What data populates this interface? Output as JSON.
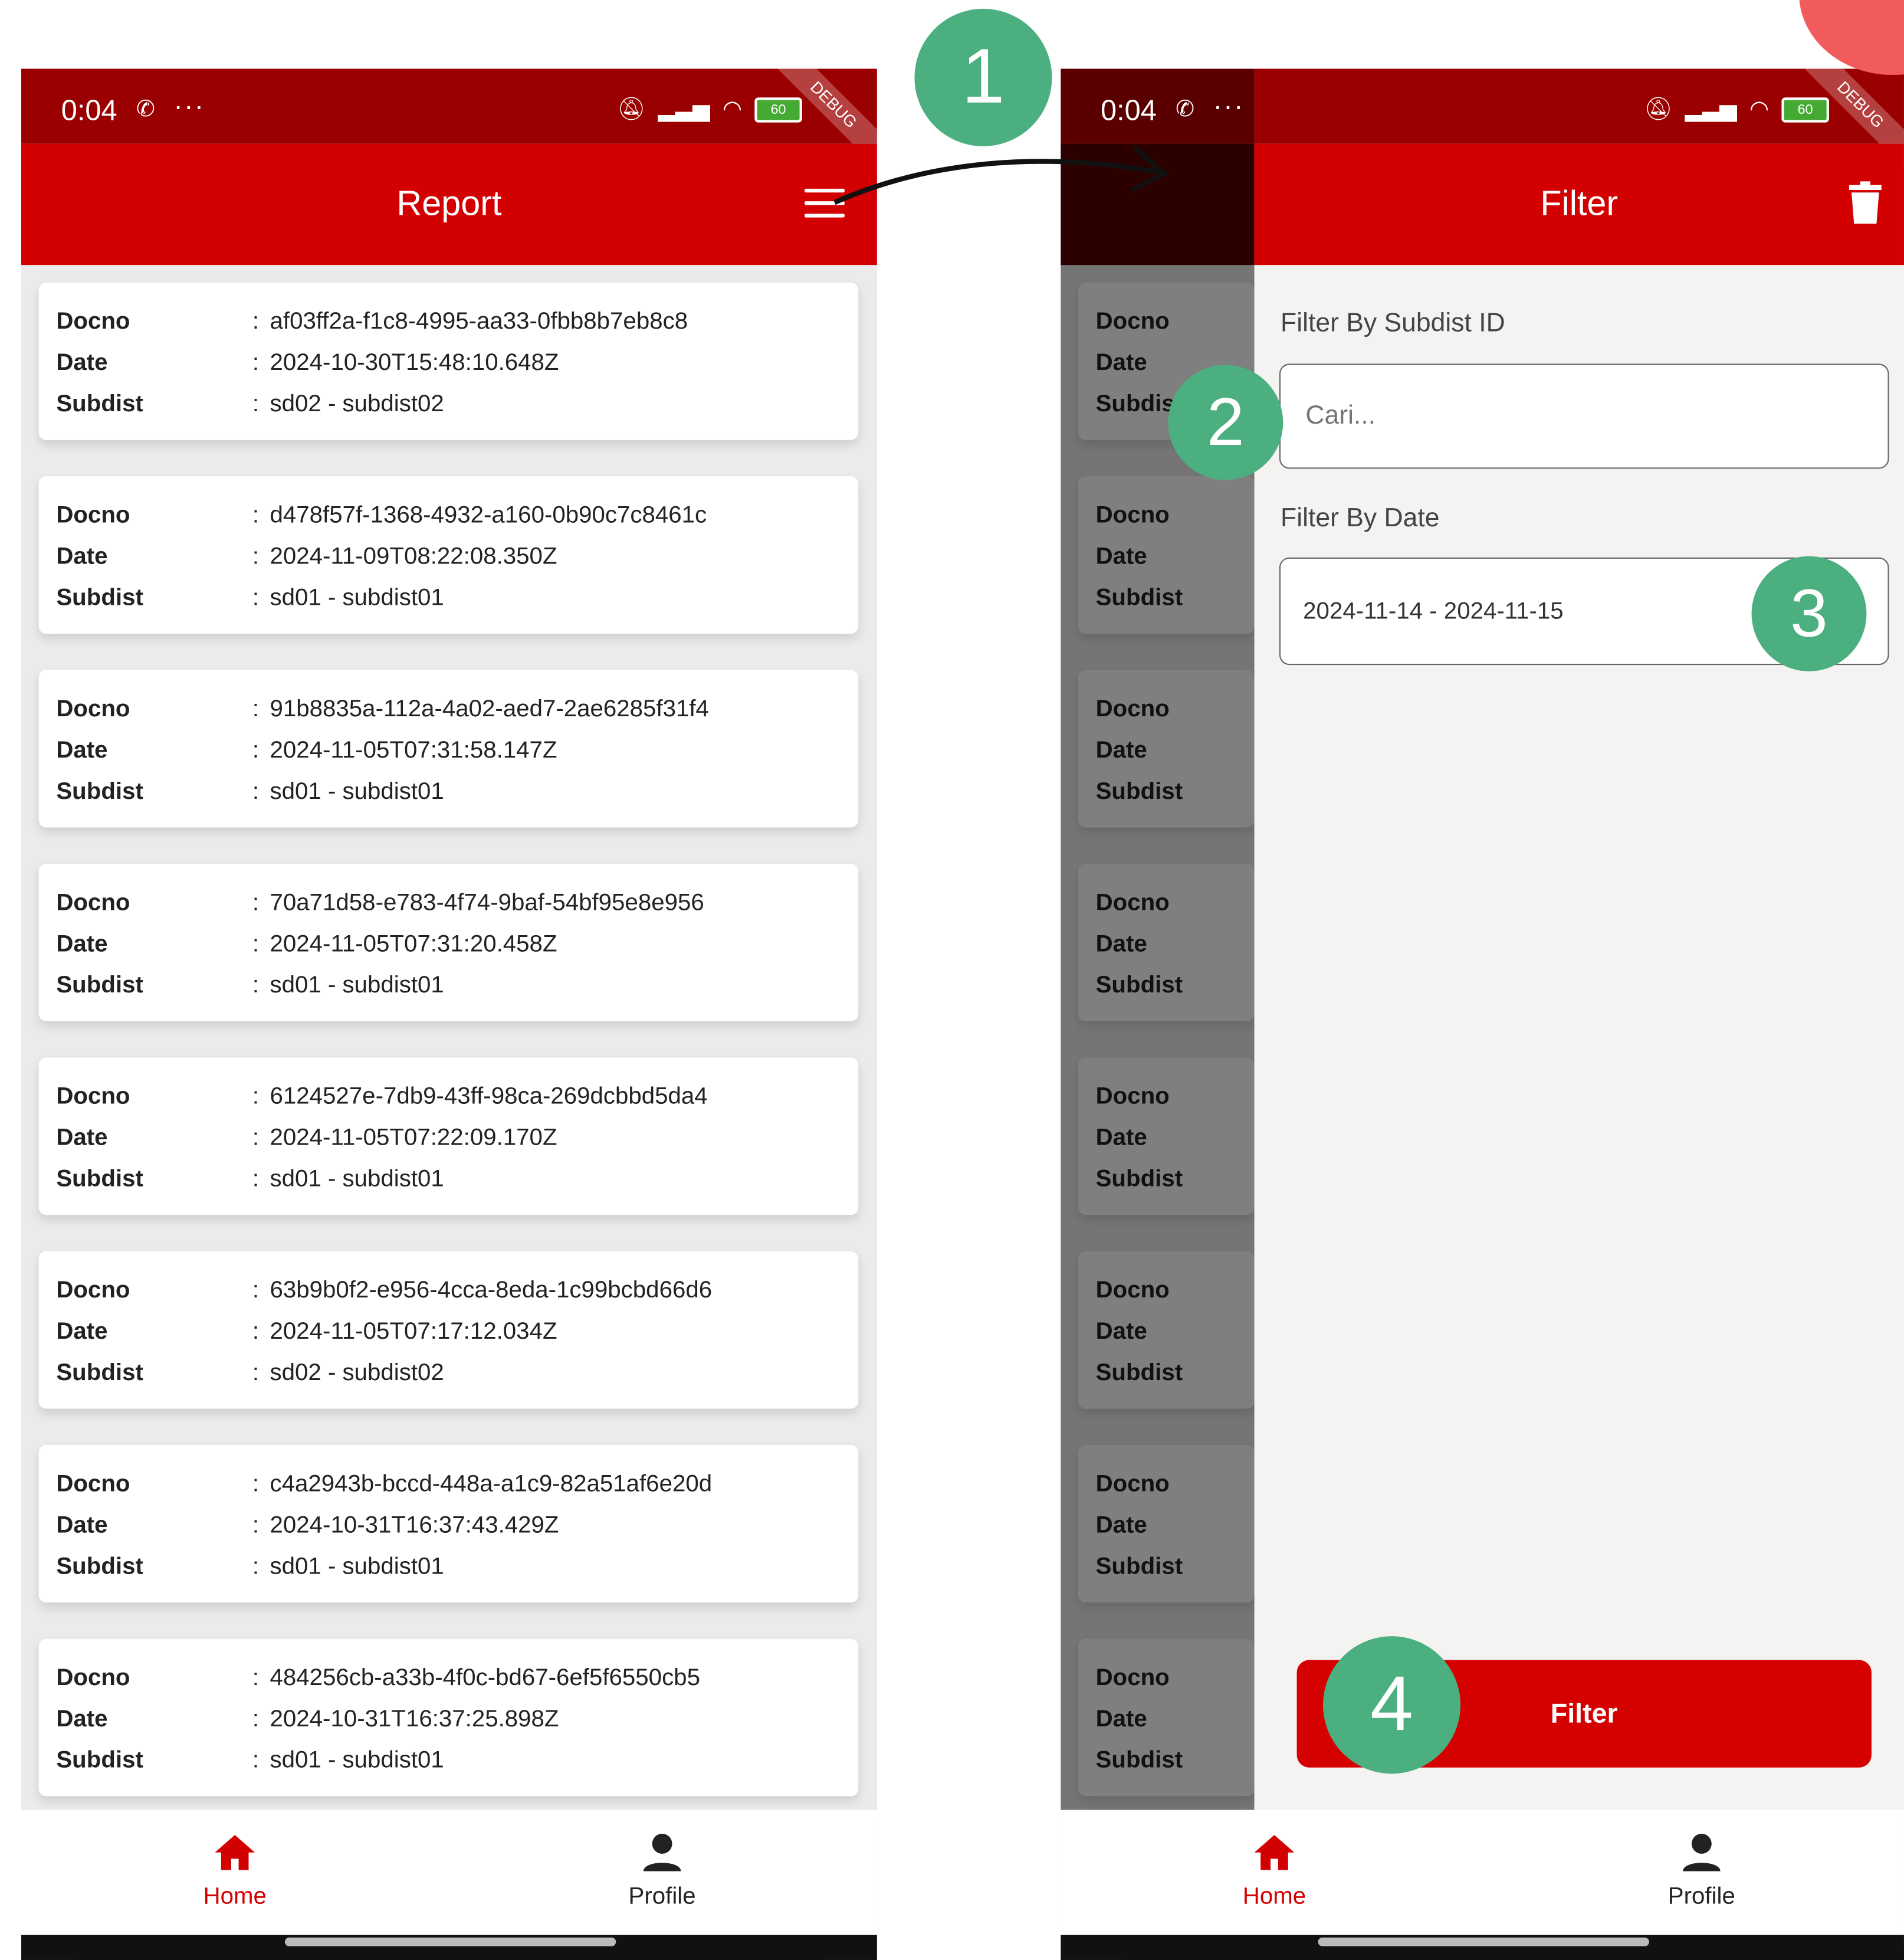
{
  "status_bar": {
    "time": "0:04",
    "battery": "60",
    "debug": "DEBUG"
  },
  "left_screen": {
    "title": "Report"
  },
  "right_screen": {
    "drawer_title": "Filter",
    "subdist_label": "Filter By Subdist ID",
    "subdist_placeholder": "Cari...",
    "date_label": "Filter By Date",
    "date_value": "2024-11-14 - 2024-11-15",
    "filter_button": "Filter"
  },
  "field_labels": {
    "docno": "Docno",
    "date": "Date",
    "subdist": "Subdist",
    "separator": ":"
  },
  "reports": [
    {
      "docno": "af03ff2a-f1c8-4995-aa33-0fbb8b7eb8c8",
      "date": "2024-10-30T15:48:10.648Z",
      "subdist": "sd02 - subdist02"
    },
    {
      "docno": "d478f57f-1368-4932-a160-0b90c7c8461c",
      "date": "2024-11-09T08:22:08.350Z",
      "subdist": "sd01 - subdist01"
    },
    {
      "docno": "91b8835a-112a-4a02-aed7-2ae6285f31f4",
      "date": "2024-11-05T07:31:58.147Z",
      "subdist": "sd01 - subdist01"
    },
    {
      "docno": "70a71d58-e783-4f74-9baf-54bf95e8e956",
      "date": "2024-11-05T07:31:20.458Z",
      "subdist": "sd01 - subdist01"
    },
    {
      "docno": "6124527e-7db9-43ff-98ca-269dcbbd5da4",
      "date": "2024-11-05T07:22:09.170Z",
      "subdist": "sd01 - subdist01"
    },
    {
      "docno": "63b9b0f2-e956-4cca-8eda-1c99bcbd66d6",
      "date": "2024-11-05T07:17:12.034Z",
      "subdist": "sd02 - subdist02"
    },
    {
      "docno": "c4a2943b-bccd-448a-a1c9-82a51af6e20d",
      "date": "2024-10-31T16:37:43.429Z",
      "subdist": "sd01 - subdist01"
    },
    {
      "docno": "484256cb-a33b-4f0c-bd67-6ef5f6550cb5",
      "date": "2024-10-31T16:37:25.898Z",
      "subdist": "sd01 - subdist01"
    }
  ],
  "bottom_nav": {
    "home": "Home",
    "profile": "Profile"
  },
  "annotations": {
    "step1": "1",
    "step2": "2",
    "step3": "3",
    "step4": "4"
  },
  "colors": {
    "brand_red": "#d20000",
    "status_dark_red": "#9b0000",
    "badge_green": "#4caf80"
  },
  "icons": {
    "menu": "menu-icon",
    "trash": "trash-icon",
    "home": "home-icon",
    "profile": "person-icon"
  }
}
